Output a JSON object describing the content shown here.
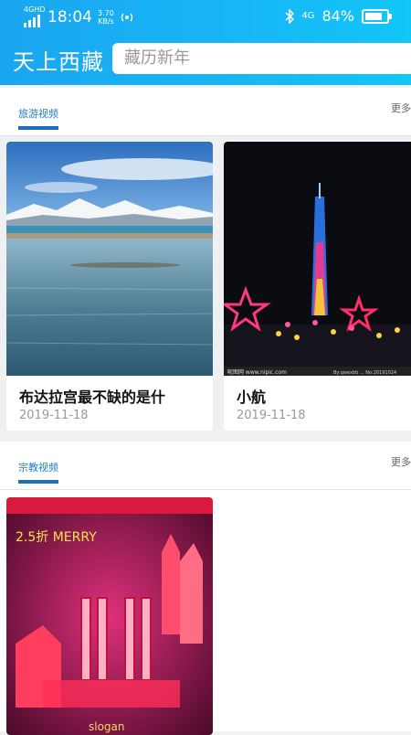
{
  "status_bar": {
    "network": "4GHD",
    "time": "18:04",
    "speed_value": "3.70",
    "speed_unit": "KB/s",
    "signal_type": "4G",
    "battery": "84%"
  },
  "header": {
    "title": "天上西藏",
    "search_placeholder": "藏历新年"
  },
  "sections": [
    {
      "tab": "旅游视频",
      "more": "更多",
      "cards": [
        {
          "title": "布达拉宫最不缺的是什",
          "date": "2019-11-18"
        },
        {
          "title": "小航",
          "date": "2019-11-18"
        }
      ]
    },
    {
      "tab": "宗教视频",
      "more": "更多",
      "cards": [
        {
          "title": "",
          "date": ""
        }
      ]
    }
  ],
  "thumb_captions": {
    "watermark_left": "昵图网 www.nipic.com",
    "watermark_right": "By:qwexbb ... No:20191024",
    "poster_text": "2.5折 MERRY",
    "poster_bottom": "slogan"
  },
  "colors": {
    "header_gradient_start": "#1aa6f0",
    "header_gradient_end": "#12c6f7",
    "tab_color": "#1c7fc4",
    "tab_underline": "#1d6fbd"
  }
}
